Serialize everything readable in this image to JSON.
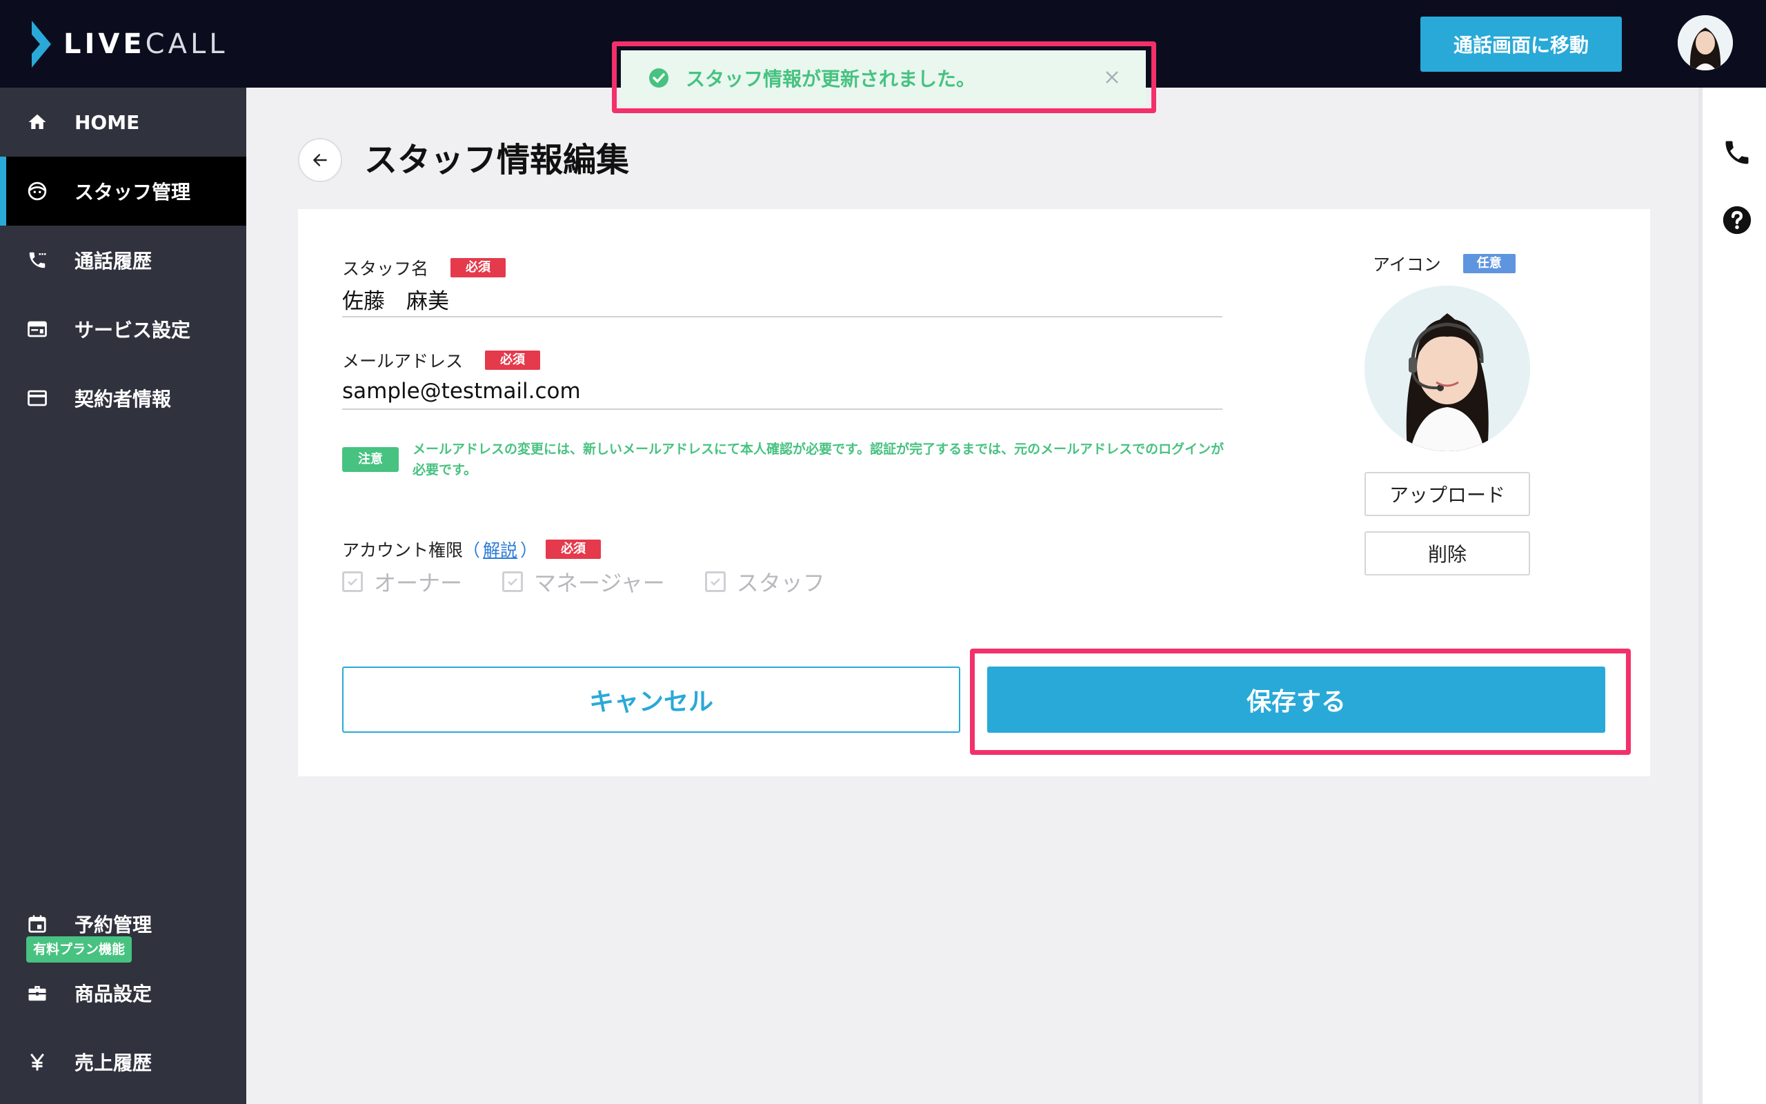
{
  "header": {
    "logo_text_bold": "LIVE",
    "logo_text_thin": "CALL",
    "call_button_label": "通話画面に移動"
  },
  "toast": {
    "message": "スタッフ情報が更新されました。"
  },
  "sidebar": {
    "items": [
      {
        "label": "HOME",
        "icon": "home-icon"
      },
      {
        "label": "スタッフ管理",
        "icon": "face-icon",
        "active": true
      },
      {
        "label": "通話履歴",
        "icon": "phone-log-icon"
      },
      {
        "label": "サービス設定",
        "icon": "service-icon"
      },
      {
        "label": "契約者情報",
        "icon": "card-icon"
      }
    ],
    "plan_badge": "有料プラン機能",
    "paid_items": [
      {
        "label": "予約管理",
        "icon": "calendar-icon"
      },
      {
        "label": "商品設定",
        "icon": "briefcase-icon"
      },
      {
        "label": "売上履歴",
        "icon": "yen-icon"
      }
    ]
  },
  "page": {
    "title": "スタッフ情報編集"
  },
  "form": {
    "name_label": "スタッフ名",
    "name_required": "必須",
    "name_value": "佐藤　麻美",
    "email_label": "メールアドレス",
    "email_required": "必須",
    "email_value": "sample@testmail.com",
    "notice_badge": "注意",
    "notice_text": "メールアドレスの変更には、新しいメールアドレスにて本人確認が必要です。認証が完了するまでは、元のメールアドレスでのログインが必要です。",
    "permission_label": "アカウント権限",
    "permission_open": "（",
    "permission_link": "解説",
    "permission_close": "）",
    "permission_required": "必須",
    "permissions": [
      "オーナー",
      "マネージャー",
      "スタッフ"
    ],
    "icon_label": "アイコン",
    "icon_optional": "任意",
    "upload_label": "アップロード",
    "delete_label": "削除",
    "cancel_label": "キャンセル",
    "save_label": "保存する"
  },
  "colors": {
    "accent": "#29a9d8",
    "header_bg": "#0b0d1e",
    "sidebar_bg": "#30323e",
    "highlight": "#f3306a",
    "success": "#47c280",
    "required": "#e43a4b",
    "optional": "#5f95df"
  }
}
